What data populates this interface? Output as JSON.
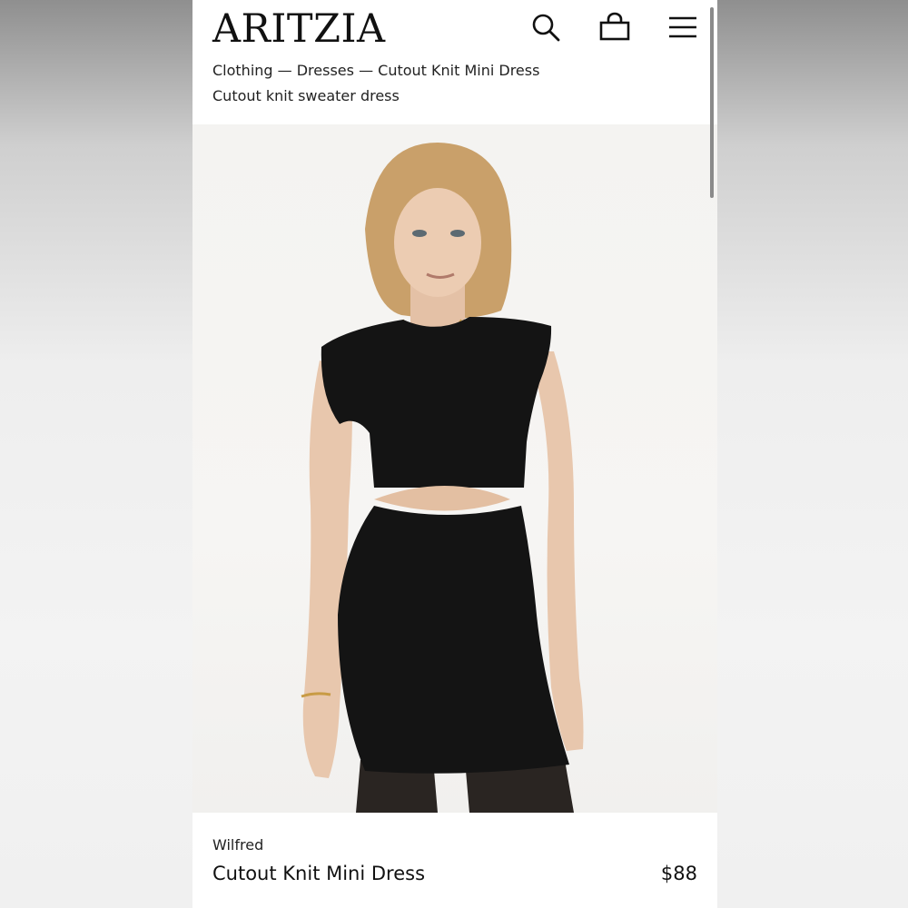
{
  "header": {
    "logo": "ARITZIA",
    "icons": {
      "search": "search-icon",
      "bag": "shopping-bag-icon",
      "menu": "menu-icon"
    }
  },
  "breadcrumb": "Clothing — Dresses — Cutout Knit Mini Dress",
  "subtitle": "Cutout knit sweater dress",
  "product": {
    "brand": "Wilfred",
    "name": "Cutout Knit Mini Dress",
    "price": "$88"
  },
  "colors": {
    "text": "#111111",
    "page_bg": "#ffffff",
    "dress": "#141414"
  }
}
